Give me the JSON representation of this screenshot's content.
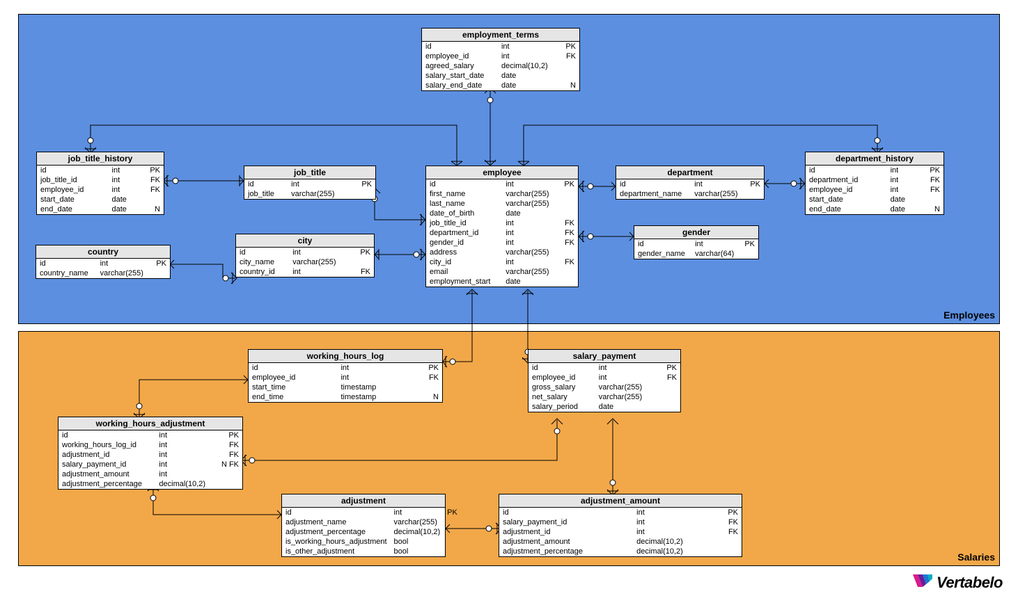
{
  "regions": {
    "employees_label": "Employees",
    "salaries_label": "Salaries"
  },
  "entities": {
    "employment_terms": {
      "title": "employment_terms",
      "cols": [
        {
          "name": "id",
          "type": "int",
          "key": "PK"
        },
        {
          "name": "employee_id",
          "type": "int",
          "key": "FK"
        },
        {
          "name": "agreed_salary",
          "type": "decimal(10,2)",
          "key": ""
        },
        {
          "name": "salary_start_date",
          "type": "date",
          "key": ""
        },
        {
          "name": "salary_end_date",
          "type": "date",
          "key": "N"
        }
      ]
    },
    "job_title_history": {
      "title": "job_title_history",
      "cols": [
        {
          "name": "id",
          "type": "int",
          "key": "PK"
        },
        {
          "name": "job_title_id",
          "type": "int",
          "key": "FK"
        },
        {
          "name": "employee_id",
          "type": "int",
          "key": "FK"
        },
        {
          "name": "start_date",
          "type": "date",
          "key": ""
        },
        {
          "name": "end_date",
          "type": "date",
          "key": "N"
        }
      ]
    },
    "job_title": {
      "title": "job_title",
      "cols": [
        {
          "name": "id",
          "type": "int",
          "key": "PK"
        },
        {
          "name": "job_title",
          "type": "varchar(255)",
          "key": ""
        }
      ]
    },
    "employee": {
      "title": "employee",
      "cols": [
        {
          "name": "id",
          "type": "int",
          "key": "PK"
        },
        {
          "name": "first_name",
          "type": "varchar(255)",
          "key": ""
        },
        {
          "name": "last_name",
          "type": "varchar(255)",
          "key": ""
        },
        {
          "name": "date_of_birth",
          "type": "date",
          "key": ""
        },
        {
          "name": "job_title_id",
          "type": "int",
          "key": "FK"
        },
        {
          "name": "department_id",
          "type": "int",
          "key": "FK"
        },
        {
          "name": "gender_id",
          "type": "int",
          "key": "FK"
        },
        {
          "name": "address",
          "type": "varchar(255)",
          "key": ""
        },
        {
          "name": "city_id",
          "type": "int",
          "key": "FK"
        },
        {
          "name": "email",
          "type": "varchar(255)",
          "key": ""
        },
        {
          "name": "employment_start",
          "type": "date",
          "key": ""
        }
      ]
    },
    "department": {
      "title": "department",
      "cols": [
        {
          "name": "id",
          "type": "int",
          "key": "PK"
        },
        {
          "name": "department_name",
          "type": "varchar(255)",
          "key": ""
        }
      ]
    },
    "department_history": {
      "title": "department_history",
      "cols": [
        {
          "name": "id",
          "type": "int",
          "key": "PK"
        },
        {
          "name": "department_id",
          "type": "int",
          "key": "FK"
        },
        {
          "name": "employee_id",
          "type": "int",
          "key": "FK"
        },
        {
          "name": "start_date",
          "type": "date",
          "key": ""
        },
        {
          "name": "end_date",
          "type": "date",
          "key": "N"
        }
      ]
    },
    "country": {
      "title": "country",
      "cols": [
        {
          "name": "id",
          "type": "int",
          "key": "PK"
        },
        {
          "name": "country_name",
          "type": "varchar(255)",
          "key": ""
        }
      ]
    },
    "city": {
      "title": "city",
      "cols": [
        {
          "name": "id",
          "type": "int",
          "key": "PK"
        },
        {
          "name": "city_name",
          "type": "varchar(255)",
          "key": ""
        },
        {
          "name": "country_id",
          "type": "int",
          "key": "FK"
        }
      ]
    },
    "gender": {
      "title": "gender",
      "cols": [
        {
          "name": "id",
          "type": "int",
          "key": "PK"
        },
        {
          "name": "gender_name",
          "type": "varchar(64)",
          "key": ""
        }
      ]
    },
    "working_hours_log": {
      "title": "working_hours_log",
      "cols": [
        {
          "name": "id",
          "type": "int",
          "key": "PK"
        },
        {
          "name": "employee_id",
          "type": "int",
          "key": "FK"
        },
        {
          "name": "start_time",
          "type": "timestamp",
          "key": ""
        },
        {
          "name": "end_time",
          "type": "timestamp",
          "key": "N"
        }
      ]
    },
    "salary_payment": {
      "title": "salary_payment",
      "cols": [
        {
          "name": "id",
          "type": "int",
          "key": "PK"
        },
        {
          "name": "employee_id",
          "type": "int",
          "key": "FK"
        },
        {
          "name": "gross_salary",
          "type": "varchar(255)",
          "key": ""
        },
        {
          "name": "net_salary",
          "type": "varchar(255)",
          "key": ""
        },
        {
          "name": "salary_period",
          "type": "date",
          "key": ""
        }
      ]
    },
    "working_hours_adjustment": {
      "title": "working_hours_adjustment",
      "cols": [
        {
          "name": "id",
          "type": "int",
          "key": "PK"
        },
        {
          "name": "working_hours_log_id",
          "type": "int",
          "key": "FK"
        },
        {
          "name": "adjustment_id",
          "type": "int",
          "key": "FK"
        },
        {
          "name": "salary_payment_id",
          "type": "int",
          "key": "N FK"
        },
        {
          "name": "adjustment_amount",
          "type": "int",
          "key": ""
        },
        {
          "name": "adjustment_percentage",
          "type": "decimal(10,2)",
          "key": ""
        }
      ]
    },
    "adjustment": {
      "title": "adjustment",
      "cols": [
        {
          "name": "id",
          "type": "int",
          "key": "PK"
        },
        {
          "name": "adjustment_name",
          "type": "varchar(255)",
          "key": ""
        },
        {
          "name": "adjustment_percentage",
          "type": "decimal(10,2)",
          "key": ""
        },
        {
          "name": "is_working_hours_adjustment",
          "type": "bool",
          "key": ""
        },
        {
          "name": "is_other_adjustment",
          "type": "bool",
          "key": ""
        }
      ]
    },
    "adjustment_amount": {
      "title": "adjustment_amount",
      "cols": [
        {
          "name": "id",
          "type": "int",
          "key": "PK"
        },
        {
          "name": "salary_payment_id",
          "type": "int",
          "key": "FK"
        },
        {
          "name": "adjustment_id",
          "type": "int",
          "key": "FK"
        },
        {
          "name": "adjustment_amount",
          "type": "decimal(10,2)",
          "key": ""
        },
        {
          "name": "adjustment_percentage",
          "type": "decimal(10,2)",
          "key": ""
        }
      ]
    }
  },
  "relationships": [
    {
      "from": "employment_terms.employee_id",
      "to": "employee.id",
      "cardinality": "many-to-one"
    },
    {
      "from": "job_title_history.job_title_id",
      "to": "job_title.id",
      "cardinality": "many-to-one"
    },
    {
      "from": "job_title_history.employee_id",
      "to": "employee.id",
      "cardinality": "many-to-one"
    },
    {
      "from": "employee.job_title_id",
      "to": "job_title.id",
      "cardinality": "many-to-one"
    },
    {
      "from": "employee.department_id",
      "to": "department.id",
      "cardinality": "many-to-one"
    },
    {
      "from": "employee.gender_id",
      "to": "gender.id",
      "cardinality": "many-to-one"
    },
    {
      "from": "employee.city_id",
      "to": "city.id",
      "cardinality": "many-to-one"
    },
    {
      "from": "department_history.department_id",
      "to": "department.id",
      "cardinality": "many-to-one"
    },
    {
      "from": "department_history.employee_id",
      "to": "employee.id",
      "cardinality": "many-to-one"
    },
    {
      "from": "city.country_id",
      "to": "country.id",
      "cardinality": "many-to-one"
    },
    {
      "from": "working_hours_log.employee_id",
      "to": "employee.id",
      "cardinality": "many-to-one"
    },
    {
      "from": "salary_payment.employee_id",
      "to": "employee.id",
      "cardinality": "many-to-one"
    },
    {
      "from": "working_hours_adjustment.working_hours_log_id",
      "to": "working_hours_log.id",
      "cardinality": "many-to-one"
    },
    {
      "from": "working_hours_adjustment.adjustment_id",
      "to": "adjustment.id",
      "cardinality": "many-to-one"
    },
    {
      "from": "working_hours_adjustment.salary_payment_id",
      "to": "salary_payment.id",
      "cardinality": "many-to-one",
      "optional": true
    },
    {
      "from": "adjustment_amount.salary_payment_id",
      "to": "salary_payment.id",
      "cardinality": "many-to-one"
    },
    {
      "from": "adjustment_amount.adjustment_id",
      "to": "adjustment.id",
      "cardinality": "many-to-one"
    }
  ],
  "brand": {
    "name": "Vertabelo"
  }
}
